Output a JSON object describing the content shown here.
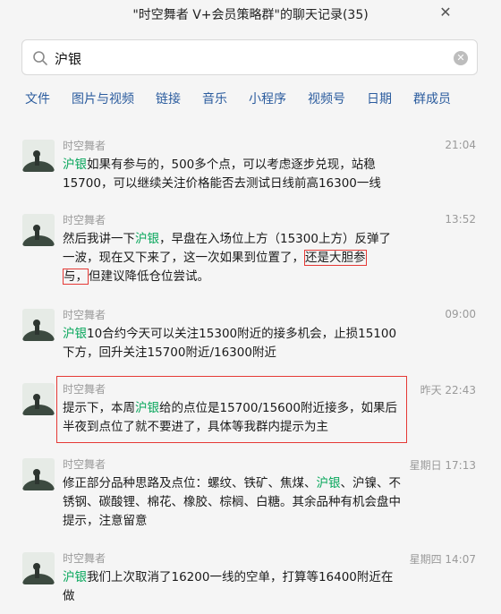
{
  "window": {
    "title": "\"时空舞者 V+会员策略群\"的聊天记录(35)",
    "close_glyph": "✕"
  },
  "search": {
    "value": "沪银",
    "clear_glyph": "✕"
  },
  "tabs": [
    "文件",
    "图片与视频",
    "链接",
    "音乐",
    "小程序",
    "视频号",
    "日期",
    "群成员"
  ],
  "colors": {
    "highlight": "#07a65b",
    "tab_text": "#2b5c9e",
    "annotation": "#e53935"
  },
  "messages": [
    {
      "sender": "时空舞者",
      "time": "21:04",
      "hl": "沪银",
      "text": "如果有参与的，500多个点，可以考虑逐步兑现，站稳15700，可以继续关注价格能否去测试日线前高16300一线"
    },
    {
      "sender": "时空舞者",
      "time": "13:52",
      "pre": "然后我讲一下",
      "hl": "沪银",
      "mid": "，早盘在入场位上方（15300上方）反弹了一波，现在又下来了，这一次如果到位置了，",
      "boxed1": "还是大胆参",
      "boxed2": "与，",
      "post": "但建议降低仓位尝试。"
    },
    {
      "sender": "时空舞者",
      "time": "09:00",
      "hl": "沪银",
      "text": "10合约今天可以关注15300附近的接多机会，止损15100下方，回升关注15700附近/16300附近"
    },
    {
      "sender": "时空舞者",
      "time": "昨天 22:43",
      "pre": "提示下，本周",
      "hl": "沪银",
      "text": "给的点位是15700/15600附近接多，如果后半夜到点位了就不要进了，具体等我群内提示为主"
    },
    {
      "sender": "时空舞者",
      "time": "星期日 17:13",
      "pre": "修正部分品种思路及点位：螺纹、铁矿、焦煤、",
      "hl": "沪银",
      "text": "、沪镍、不锈钢、碳酸锂、棉花、橡胶、棕榈、白糖。其余品种有机会盘中提示，注意留意"
    },
    {
      "sender": "时空舞者",
      "time": "星期四 14:07",
      "hl": "沪银",
      "text": "我们上次取消了16200一线的空单，打算等16400附近在做"
    }
  ]
}
